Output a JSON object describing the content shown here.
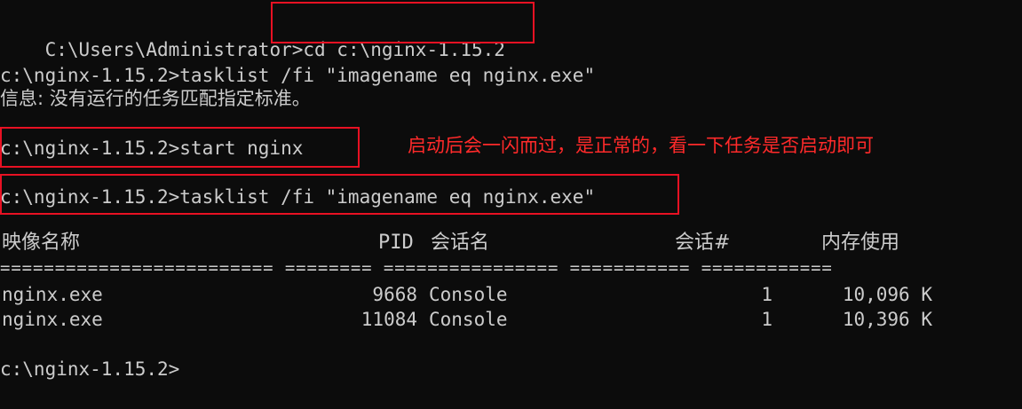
{
  "colors": {
    "background": "#0c0c0c",
    "text": "#cccccc",
    "highlight_box": "#e81123",
    "annotation": "#ff2a2a"
  },
  "lines": {
    "l1_prompt": "C:\\Users\\Administrator>",
    "l1_cmd": "cd c:\\nginx-1.15.2",
    "l2": "c:\\nginx-1.15.2>tasklist /fi \"imagename eq nginx.exe\"",
    "l3": "信息: 没有运行的任务匹配指定标准。",
    "l4": "c:\\nginx-1.15.2>start nginx",
    "l5": "c:\\nginx-1.15.2>tasklist /fi \"imagename eq nginx.exe\"",
    "last_prompt": "c:\\nginx-1.15.2>"
  },
  "annotation": "启动后会一闪而过，是正常的，看一下任务是否启动即可",
  "table": {
    "headers": {
      "image_name": "映像名称",
      "pid": "PID",
      "session_name": "会话名",
      "session_num": "会话#",
      "mem_usage": "内存使用"
    },
    "separator": "========================= ======== ================ =========== ============",
    "rows": [
      {
        "image_name": "nginx.exe",
        "pid": "9668",
        "session_name": "Console",
        "session_num": "1",
        "mem_usage": "10,096 K"
      },
      {
        "image_name": "nginx.exe",
        "pid": "11084",
        "session_name": "Console",
        "session_num": "1",
        "mem_usage": "10,396 K"
      }
    ]
  }
}
